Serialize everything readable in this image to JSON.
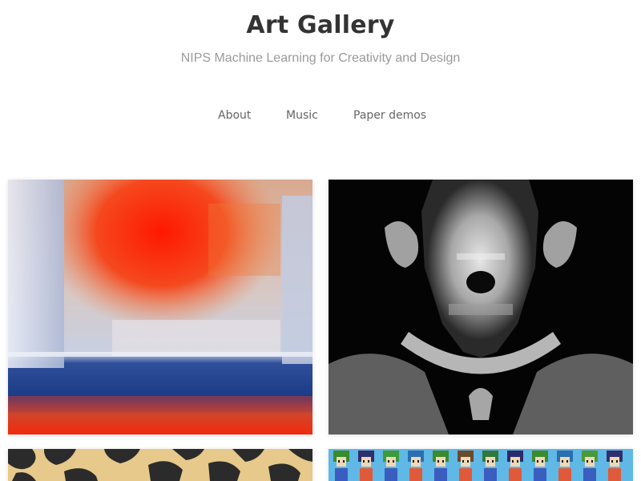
{
  "header": {
    "title": "Art Gallery",
    "subtitle": "NIPS Machine Learning for Creativity and Design"
  },
  "nav": {
    "items": [
      {
        "label": "About"
      },
      {
        "label": "Music"
      },
      {
        "label": "Paper demos"
      }
    ]
  },
  "gallery": {
    "artworks": [
      {
        "icon": "abstract-painting-image",
        "palette": [
          "#f03a1a",
          "#c9d3e8",
          "#1a3f8f"
        ]
      },
      {
        "icon": "monochrome-face-image",
        "palette": [
          "#000000",
          "#d8d8d8",
          "#7a7a7a"
        ]
      },
      {
        "icon": "camouflage-pattern-image",
        "palette": [
          "#e8c98a",
          "#2b2b2b"
        ]
      },
      {
        "icon": "pixel-characters-image",
        "palette": [
          "#5fb8e6",
          "#2a8a3a",
          "#e9d3a8"
        ]
      }
    ]
  },
  "colors": {
    "title": "#333333",
    "subtitle": "#9a9a9a",
    "nav": "#666666",
    "background": "#ffffff"
  }
}
